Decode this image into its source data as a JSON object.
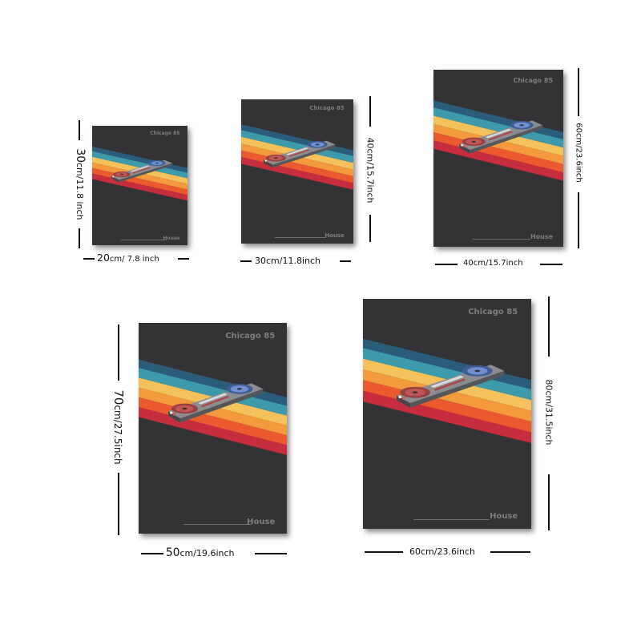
{
  "poster": {
    "title": "Chicago 85",
    "subtitle": "House"
  },
  "colors": {
    "background": "#333335",
    "stripes": [
      "#2b5c7a",
      "#3d9aab",
      "#f4c25a",
      "#f39a3d",
      "#ea5a2e",
      "#c62d3d"
    ],
    "text": "#7d7d80"
  },
  "sizes": [
    {
      "width_num": "20",
      "width_unit": "cm/ 7.8 inch",
      "height_num": "30",
      "height_unit": "cm/11.8 inch"
    },
    {
      "width_num": "",
      "width_unit": "30cm/11.8inch",
      "height_num": "",
      "height_unit": "40cm/15.7inch"
    },
    {
      "width_num": "",
      "width_unit": "40cm/15.7inch",
      "height_num": "",
      "height_unit": "60cm/23.6inch"
    },
    {
      "width_num": "50",
      "width_unit": "cm/19.6inch",
      "height_num": "70",
      "height_unit": "cm/27.5inch"
    },
    {
      "width_num": "",
      "width_unit": "60cm/23.6inch",
      "height_num": "",
      "height_unit": "80cm/31.5inch"
    }
  ]
}
